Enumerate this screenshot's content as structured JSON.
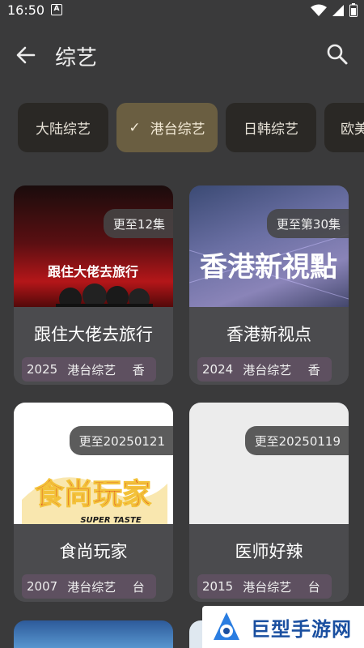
{
  "status": {
    "time": "16:50",
    "notif_letter": "A"
  },
  "header": {
    "title": "综艺"
  },
  "filters": [
    {
      "label": "大陆综艺",
      "selected": false
    },
    {
      "label": "港台综艺",
      "selected": true
    },
    {
      "label": "日韩综艺",
      "selected": false
    },
    {
      "label": "欧美",
      "selected": false
    }
  ],
  "cards": [
    {
      "badge": "更至12集",
      "title": "跟住大佬去旅行",
      "year": "2025",
      "category": "港台综艺",
      "region": "香",
      "poster_text": "跟住大佬去旅行"
    },
    {
      "badge": "更至第30集",
      "title": "香港新视点",
      "year": "2024",
      "category": "港台综艺",
      "region": "香",
      "poster_text": "香港新視點"
    },
    {
      "badge": "更至20250121",
      "title": "食尚玩家",
      "year": "2007",
      "category": "港台综艺",
      "region": "台",
      "poster_text": "食尚玩家",
      "poster_sub": "SUPER TASTE"
    },
    {
      "badge": "更至20250119",
      "title": "医师好辣",
      "year": "2015",
      "category": "港台综艺",
      "region": "台"
    }
  ],
  "watermark": {
    "text": "巨型手游网"
  },
  "icons": {
    "back": "arrow-left-icon",
    "search": "search-icon",
    "check": "check-icon"
  }
}
